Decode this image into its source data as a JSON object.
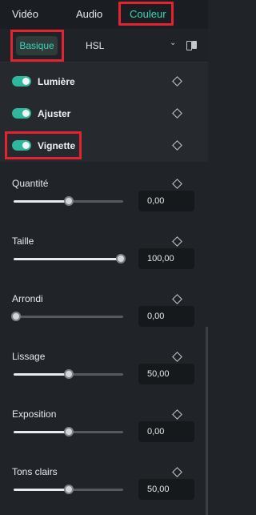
{
  "tabs": {
    "video": "Vidéo",
    "audio": "Audio",
    "couleur": "Couleur"
  },
  "subtabs": {
    "basique": "Basique",
    "hsl": "HSL"
  },
  "sections": [
    {
      "label": "Lumière",
      "enabled": true
    },
    {
      "label": "Ajuster",
      "enabled": true
    },
    {
      "label": "Vignette",
      "enabled": true
    }
  ],
  "sliders": [
    {
      "label": "Quantité",
      "value": "0,00",
      "position": 0.5
    },
    {
      "label": "Taille",
      "value": "100,00",
      "position": 1.0
    },
    {
      "label": "Arrondi",
      "value": "0,00",
      "position": 0.0
    },
    {
      "label": "Lissage",
      "value": "50,00",
      "position": 0.5
    },
    {
      "label": "Exposition",
      "value": "0,00",
      "position": 0.5
    },
    {
      "label": "Tons clairs",
      "value": "50,00",
      "position": 0.5
    }
  ],
  "colors": {
    "accent": "#39d6b9",
    "highlight": "#e3232f"
  }
}
